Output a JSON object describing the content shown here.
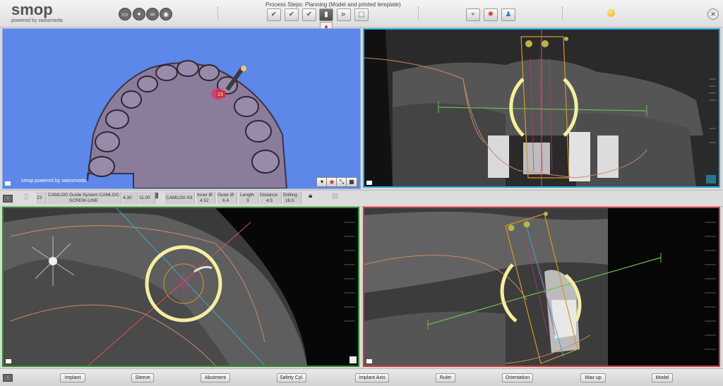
{
  "app": {
    "logo": "smop",
    "logo_sub": "powered by swissmeda"
  },
  "header": {
    "tools": [
      {
        "icon": "monitor-icon"
      },
      {
        "icon": "lightbulb-icon"
      },
      {
        "icon": "glasses-icon"
      },
      {
        "icon": "camera-icon"
      }
    ],
    "process_title": "Process Steps: Planning (Model and printed template)",
    "steps": [
      {
        "icon": "check-scan-icon"
      },
      {
        "icon": "check-model-icon"
      },
      {
        "icon": "check-teeth-icon"
      },
      {
        "icon": "implant-step-icon"
      },
      {
        "icon": "export-step-icon"
      },
      {
        "icon": "template-step-icon"
      }
    ],
    "tools_right": [
      {
        "icon": "crosshair-icon"
      },
      {
        "icon": "virus-icon"
      },
      {
        "icon": "tooth-icon"
      }
    ],
    "status_color": "#f3b000"
  },
  "viewer3d": {
    "watermark": "smop powered by swissmeda",
    "tooth_label": "23",
    "background": "#5d87e9"
  },
  "implant_info": {
    "position": "23",
    "system": "CAMLOG Guide System CAMLOG",
    "line": "SCREW-LINE",
    "diameter": "4.30",
    "length": "11.00",
    "kit": "CAMLOG Kit",
    "inner_label": "Inner Ø",
    "inner": "4.52",
    "outer_label": "Outer Ø",
    "outer": "6.4",
    "length_label": "Length",
    "length_val": "3",
    "distance_label": "Distance",
    "distance": "4.5",
    "drilling_label": "Drilling",
    "drilling": "18.5"
  },
  "view_colors": {
    "coronal": "#2aa7d6",
    "axial": "#2e8f2e",
    "sagittal": "#d03a3a"
  },
  "bottom": {
    "buttons": [
      "Implant",
      "Sleeve",
      "Abutment",
      "Safety Cyl.",
      "Implant Axis",
      "Ruler",
      "Orientation",
      "Wax up",
      "Model"
    ]
  }
}
